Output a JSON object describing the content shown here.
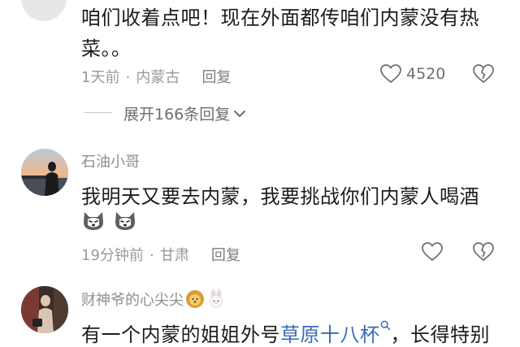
{
  "comment1": {
    "text_line1": "咱们收着点吧！现在外面都传咱们内蒙没有热",
    "text_line2": "菜。。",
    "time": "1天前",
    "location": "内蒙古",
    "meta_sep": "·",
    "reply_label": "回复",
    "likes": "4520",
    "expand_label": "展开166条回复"
  },
  "comment2": {
    "username": "石油小哥",
    "text": "我明天又要去内蒙，我要挑战你们内蒙人喝酒",
    "time": "19分钟前",
    "location": "甘肃",
    "meta_sep": "·",
    "reply_label": "回复"
  },
  "comment3": {
    "username": "财神爷的心尖尖",
    "text_before": "有一个内蒙的姐姐外号",
    "link_text": "草原十八杯",
    "text_after": "，长得特别"
  },
  "colors": {
    "text": "#1c1c1c",
    "meta": "#9a9a9a",
    "link": "#3b6bb5"
  }
}
